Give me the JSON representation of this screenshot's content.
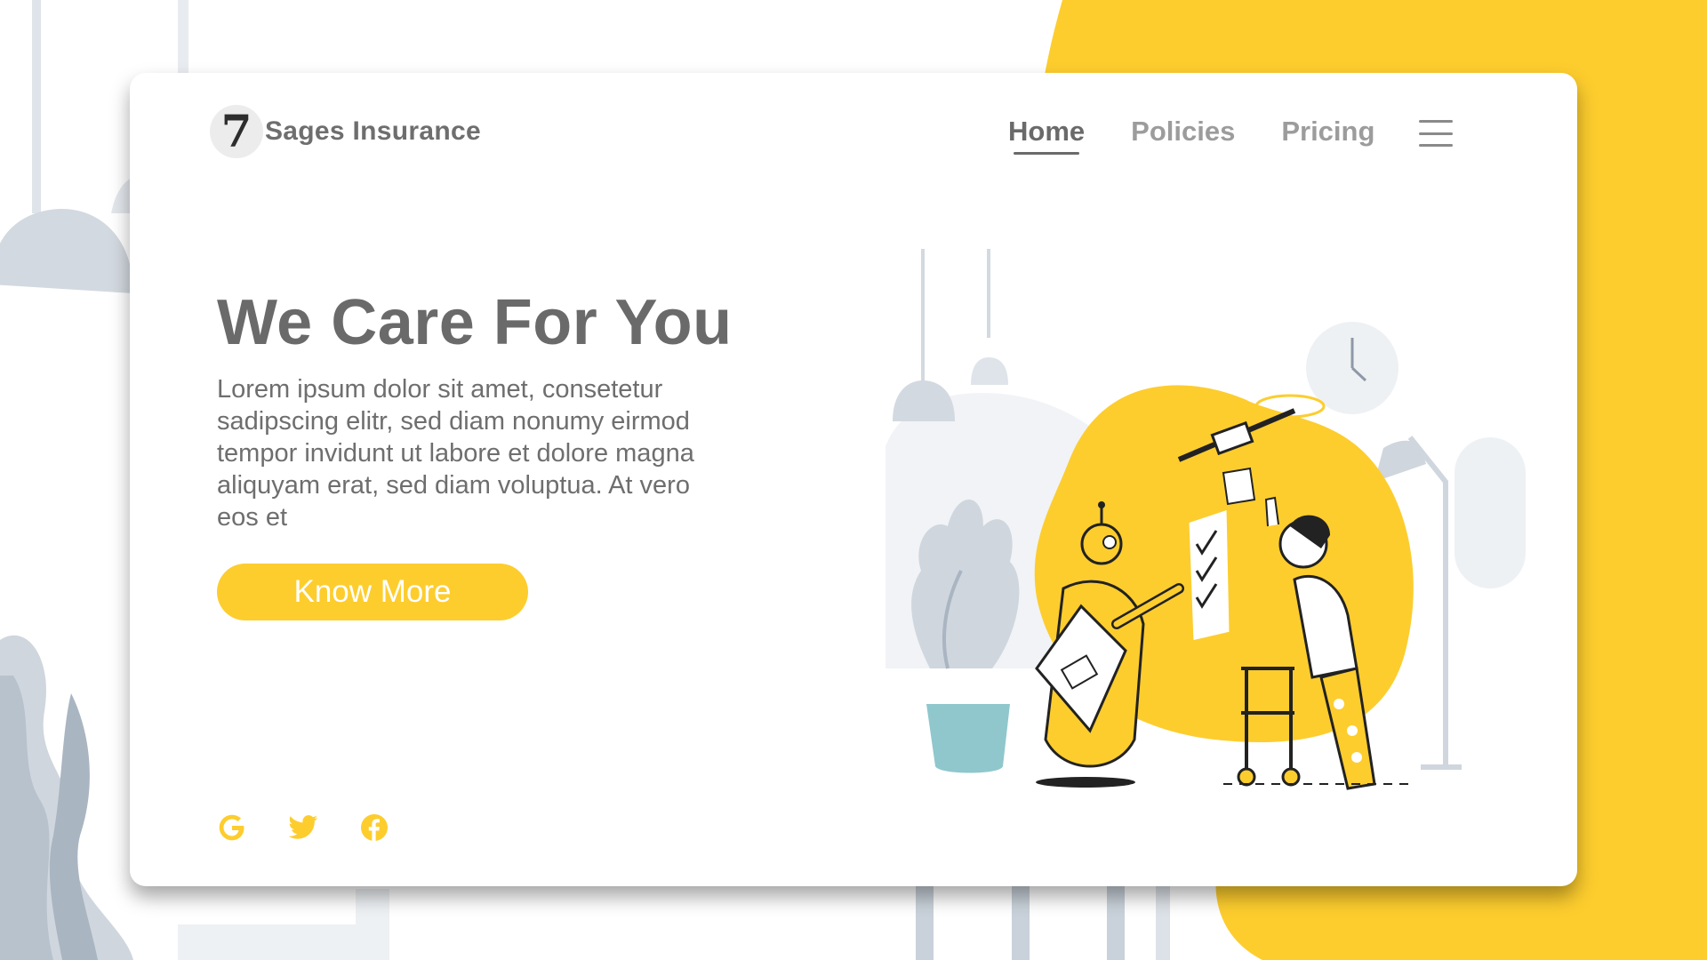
{
  "brand": {
    "logo_glyph": "7",
    "name": "Sages Insurance"
  },
  "nav": {
    "items": [
      {
        "label": "Home",
        "active": true
      },
      {
        "label": "Policies",
        "active": false
      },
      {
        "label": "Pricing",
        "active": false
      }
    ],
    "menu_icon": "hamburger-icon"
  },
  "hero": {
    "title": "We Care For You",
    "body": "Lorem ipsum dolor sit amet, consetetur sadipscing elitr, sed diam nonumy eirmod tempor invidunt ut labore et dolore magna aliquyam erat, sed diam voluptua. At vero eos et",
    "cta_label": "Know More"
  },
  "social": {
    "icons": [
      "google-icon",
      "twitter-icon",
      "facebook-icon"
    ]
  },
  "colors": {
    "accent": "#fdcd2e",
    "text_dark": "#6a6a6a",
    "text_muted": "#9c9c9c",
    "decor_gray": "#d3d9e0"
  }
}
